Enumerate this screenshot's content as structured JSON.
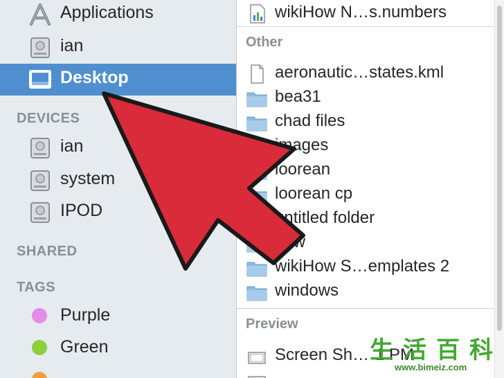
{
  "colors": {
    "sidebar_bg": "#e6ebf0",
    "selection": "#4f8fcf",
    "section_header": "#8a8f96",
    "arrow_fill": "#d92b3a",
    "arrow_stroke": "#1a1a1a",
    "folder_blue": "#8fbbe0"
  },
  "sidebar": {
    "favorites": [
      {
        "label": "Applications",
        "icon": "applications-icon"
      },
      {
        "label": "ian",
        "icon": "home-drive-icon"
      },
      {
        "label": "Desktop",
        "icon": "desktop-icon",
        "selected": true
      }
    ],
    "devices_header": "DEVICES",
    "devices": [
      {
        "label": "ian",
        "icon": "hard-drive-icon"
      },
      {
        "label": "system",
        "icon": "hard-drive-icon"
      },
      {
        "label": "IPOD",
        "icon": "hard-drive-icon"
      }
    ],
    "shared_header": "SHARED",
    "tags_header": "TAGS",
    "tags": [
      {
        "label": "Purple",
        "color": "#e48be8"
      },
      {
        "label": "Green",
        "color": "#8fcf3c"
      }
    ]
  },
  "files": {
    "top_item": {
      "name": "wikiHow N…s.numbers",
      "icon": "numbers-document-icon"
    },
    "other_header": "Other",
    "other_items": [
      {
        "name": "aeronautic…states.kml",
        "icon": "document-icon"
      },
      {
        "name": "bea31",
        "icon": "folder-icon"
      },
      {
        "name": "chad files",
        "icon": "folder-icon"
      },
      {
        "name": "images",
        "icon": "folder-icon"
      },
      {
        "name": "loorean",
        "icon": "folder-icon"
      },
      {
        "name": "loorean cp",
        "icon": "folder-icon"
      },
      {
        "name": "untitled folder",
        "icon": "folder-icon"
      },
      {
        "name": "new",
        "icon": "folder-icon"
      },
      {
        "name": "wikiHow S…emplates 2",
        "icon": "folder-icon"
      },
      {
        "name": "windows",
        "icon": "folder-icon"
      }
    ],
    "preview_header": "Preview",
    "preview_items": [
      {
        "name": "Screen Sh…",
        "suffix": "1 PM",
        "icon": "screenshot-icon"
      }
    ]
  },
  "watermark": {
    "glyphs": [
      "生",
      "活",
      "百",
      "科"
    ],
    "url": "www.bimeiz.com"
  }
}
